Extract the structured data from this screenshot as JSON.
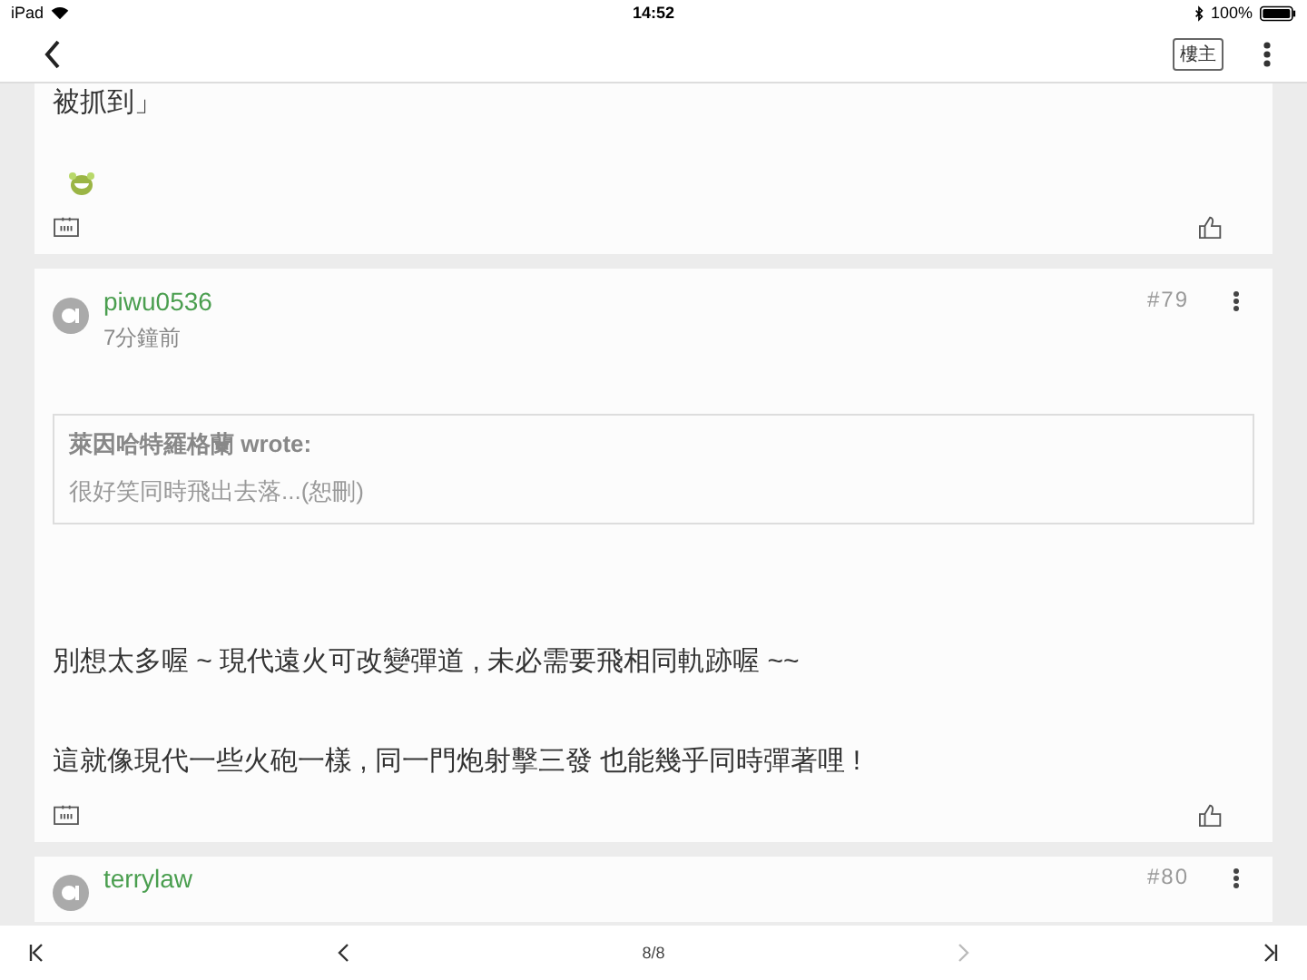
{
  "status_bar": {
    "device": "iPad",
    "time": "14:52",
    "battery": "100%"
  },
  "nav": {
    "badge": "樓主"
  },
  "previous_post": {
    "text": "被抓到」"
  },
  "posts": [
    {
      "username": "piwu0536",
      "time": "7分鐘前",
      "number": "#79",
      "quote": {
        "author": "萊因哈特羅格蘭 wrote:",
        "text": "很好笑同時飛出去落...(恕刪)"
      },
      "paragraphs": [
        "別想太多喔 ~ 現代遠火可改變彈道 , 未必需要飛相同軌跡喔 ~~",
        "這就像現代一些火砲一樣 , 同一門炮射擊三發 也能幾乎同時彈著哩 !"
      ]
    },
    {
      "username": "terrylaw",
      "number": "#80"
    }
  ],
  "pager": {
    "page": "8/8",
    "buttons": [
      {
        "kind": "first",
        "disabled": false
      },
      {
        "kind": "prev",
        "disabled": false
      },
      {
        "kind": "next",
        "disabled": true
      },
      {
        "kind": "last",
        "disabled": false
      }
    ]
  }
}
